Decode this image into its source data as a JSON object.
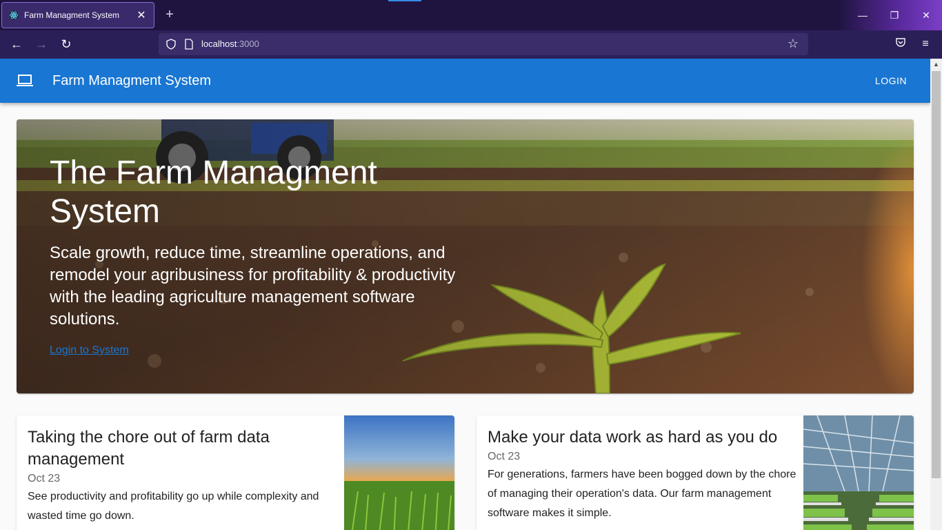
{
  "browser": {
    "tab_title": "Farm Managment System",
    "url_host": "localhost",
    "url_port": ":3000"
  },
  "appbar": {
    "brand": "Farm Managment System",
    "login_label": "LOGIN"
  },
  "hero": {
    "title": "The Farm Managment System",
    "subtitle": "Scale growth, reduce time, streamline operations, and remodel your agribusiness for profitability & productivity with the leading agriculture management software solutions.",
    "link_label": "Login to System"
  },
  "cards": [
    {
      "title": "Taking the chore out of farm data management",
      "date": "Oct 23",
      "description": "See productivity and profitability go up while complexity and wasted time go down."
    },
    {
      "title": "Make your data work as hard as you do",
      "date": "Oct 23",
      "description": "For generations, farmers have been bogged down by the chore of managing their operation's data. Our farm management software makes it simple."
    }
  ],
  "colors": {
    "primary": "#1976d2",
    "browser_bg": "#1f1440",
    "toolbar_bg": "#2b1f58"
  }
}
